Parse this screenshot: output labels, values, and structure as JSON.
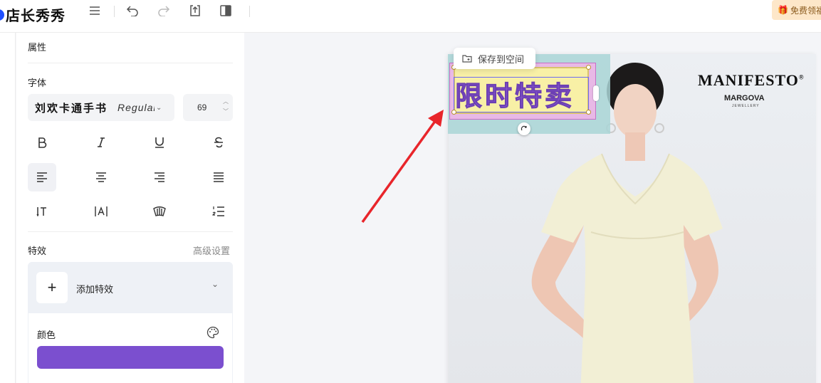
{
  "app": {
    "logo_text": "店长秀秀"
  },
  "toolbar": {
    "menu_icon": "menu-icon",
    "undo_icon": "undo-icon",
    "redo_icon": "redo-icon",
    "export_icon": "export-icon",
    "compare_icon": "compare-icon",
    "promo_label": "免费领福"
  },
  "panel": {
    "title": "属性",
    "font_section_label": "字体",
    "font_name": "刘欢卡通手书",
    "font_weight": "Regular",
    "font_size": "69",
    "effects_label": "特效",
    "advanced_settings": "高级设置",
    "add_effect_label": "添加特效",
    "color_label": "颜色",
    "color_value": "#7b4fcf"
  },
  "canvas": {
    "save_to_space": "保存到空间",
    "text_content": "限时特卖",
    "brand_name": "MANIFESTO",
    "brand_registered": "®",
    "sub_brand": "MARGOVA",
    "sub_brand_tagline": "JEWELLERY"
  }
}
